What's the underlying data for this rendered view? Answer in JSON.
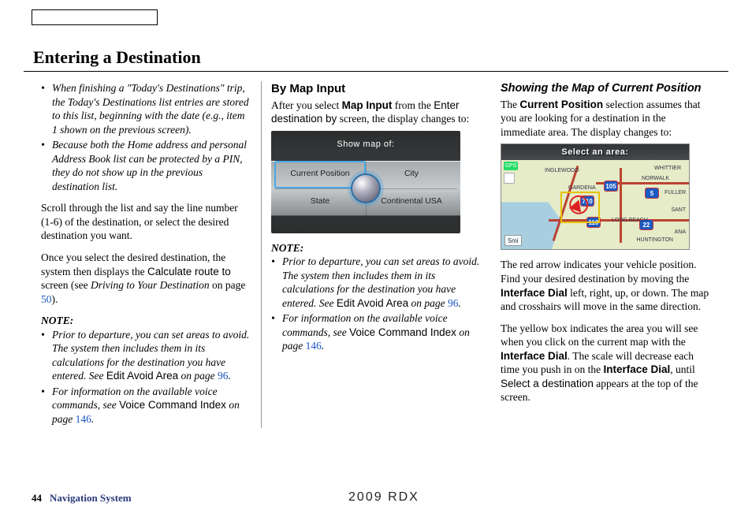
{
  "header": {
    "title": "Entering a Destination"
  },
  "col1": {
    "bullets": [
      "When finishing a \"Today's Destinations\" trip, the Today's Destinations list entries are stored to this list, beginning with the date (e.g., item 1 shown on the previous screen).",
      "Because both the Home address and personal Address Book list can be protected by a PIN, they do not show up in the previous destination list."
    ],
    "p1": "Scroll through the list and say the line number (1-6) of the destination, or select the desired destination you want.",
    "p2a": "Once you select the desired destination, the system then displays the ",
    "p2_sans": "Calculate route to",
    "p2b": " screen (see ",
    "p2_ital": "Driving to Your Destination",
    "p2c": " on page ",
    "p2_link": "50",
    "p2d": ").",
    "note_label": "NOTE:",
    "note_bullets_a": "Prior to departure, you can set areas to avoid. The system then includes them in its calculations for the destination you have entered. See ",
    "note_a_sans": "Edit Avoid Area",
    "note_a_mid": " on page ",
    "note_a_link": "96",
    "note_a_end": ".",
    "note_bullets_b": "For information on the available voice commands, see ",
    "note_b_sans": "Voice Command Index",
    "note_b_mid": " on page ",
    "note_b_link": "146",
    "note_b_end": "."
  },
  "col2": {
    "heading": "By Map Input",
    "p1a": "After you select ",
    "p1_bold": "Map Input",
    "p1b": " from the ",
    "p1_sans": "Enter destination by",
    "p1c": " screen, the display changes to:",
    "fig": {
      "title": "Show map of:",
      "opts": [
        "Current Position",
        "City",
        "State",
        "Continental USA"
      ]
    },
    "note_label": "NOTE:",
    "note_bullets_a": "Prior to departure, you can set areas to avoid. The system then includes them in its calculations for the destination you have entered. See ",
    "note_a_sans": "Edit Avoid Area",
    "note_a_mid": " on page ",
    "note_a_link": "96",
    "note_a_end": ".",
    "note_bullets_b": "For information on the available voice commands, see ",
    "note_b_sans": "Voice Command Index",
    "note_b_mid": " on page ",
    "note_b_link": "146",
    "note_b_end": "."
  },
  "col3": {
    "heading": "Showing the Map of Current Position",
    "p1a": "The ",
    "p1_bold": "Current Position",
    "p1b": " selection assumes that you are looking for a destination in the immediate area. The display changes to:",
    "fig": {
      "title": "Select an area:",
      "gps": "GPS",
      "scale": "5mi",
      "hw": [
        "105",
        "710",
        "5",
        "110",
        "22"
      ],
      "cities": [
        "WHITTIER",
        "NORWALK",
        "GARDENA",
        "INGLEWOOD",
        "FULLER",
        "LONG BEACH",
        "HUNTINGTON",
        "ANA",
        "SANT"
      ]
    },
    "p2a": "The red arrow indicates your vehicle position. Find your desired destination by moving the ",
    "p2_bold1": "Interface Dial",
    "p2b": " left, right, up, or down. The map and crosshairs will move in the same direction.",
    "p3a": "The yellow box indicates the area you will see when you click on the current map with the ",
    "p3_bold1": "Interface Dial",
    "p3b": ". The scale will decrease each time you push in on the ",
    "p3_bold2": "Interface Dial",
    "p3c": ", until ",
    "p3_sans": "Select a destination",
    "p3d": " appears at the top of the screen."
  },
  "footer": {
    "page": "44",
    "section": "Navigation System",
    "doc": "2009  RDX"
  }
}
